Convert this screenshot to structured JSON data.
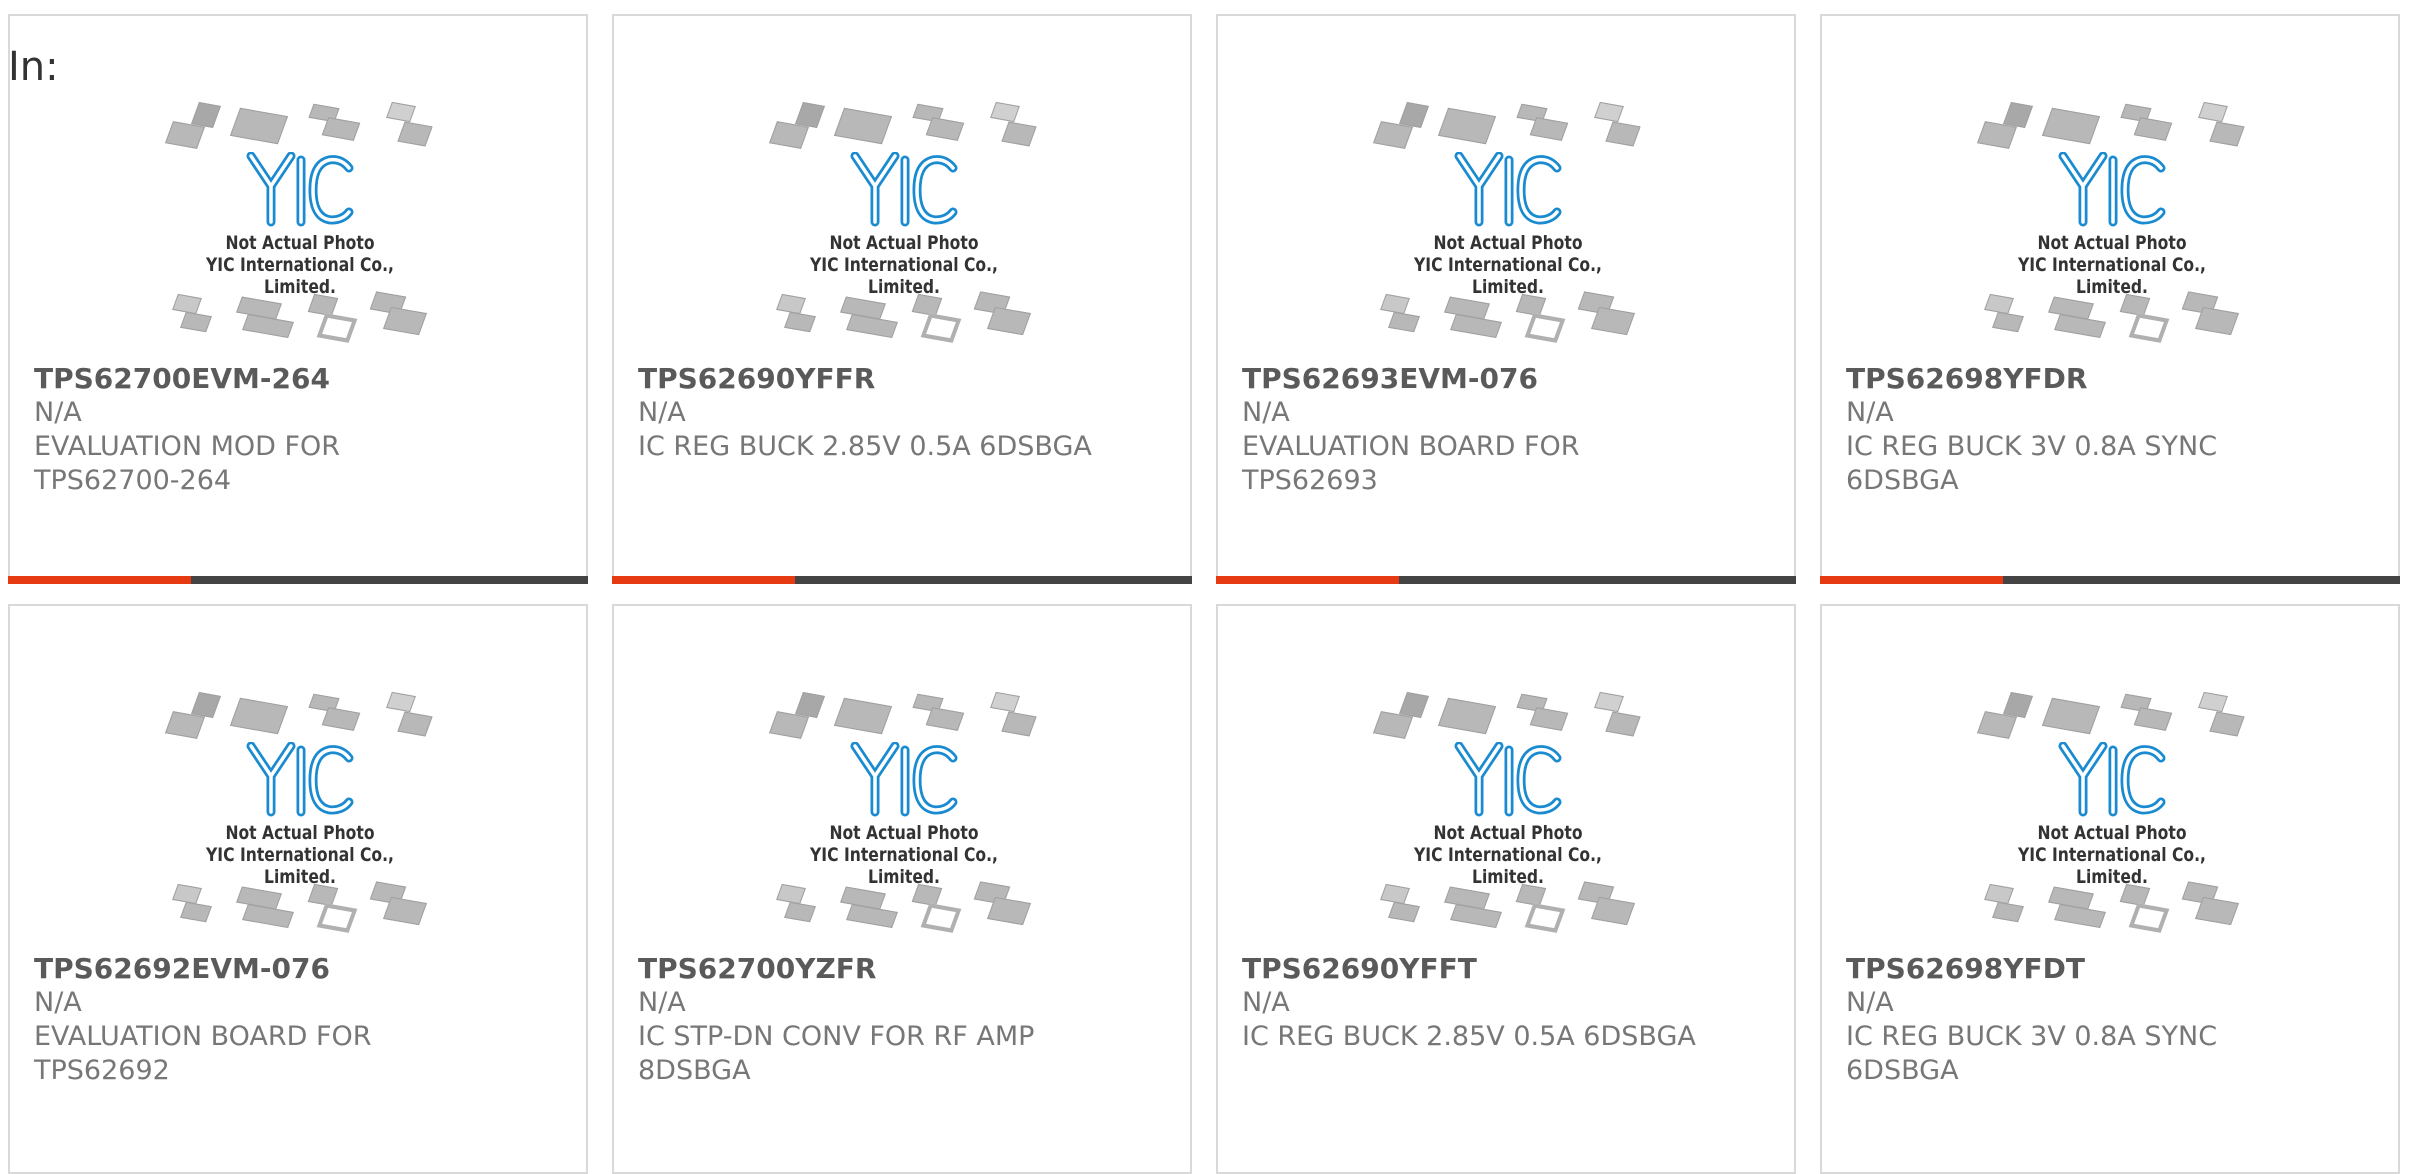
{
  "header": {
    "label": "In:"
  },
  "image": {
    "caption_line1": "Not Actual Photo",
    "caption_line2": "YIC International Co., Limited.",
    "logo_text": "YIC"
  },
  "colors": {
    "accent": "#e53a12",
    "bar_dark": "#444444",
    "logo_blue": "#1a8bd0",
    "border": "#d9d9d9"
  },
  "products": [
    {
      "part": "TPS62700EVM-264",
      "stock": "N/A",
      "desc1": "EVALUATION MOD FOR",
      "desc2": "TPS62700-264"
    },
    {
      "part": "TPS62690YFFR",
      "stock": "N/A",
      "desc1": "IC REG BUCK 2.85V 0.5A 6DSBGA",
      "desc2": ""
    },
    {
      "part": "TPS62693EVM-076",
      "stock": "N/A",
      "desc1": "EVALUATION BOARD FOR",
      "desc2": "TPS62693"
    },
    {
      "part": "TPS62698YFDR",
      "stock": "N/A",
      "desc1": "IC REG BUCK 3V 0.8A SYNC",
      "desc2": "6DSBGA"
    },
    {
      "part": "TPS62692EVM-076",
      "stock": "N/A",
      "desc1": "EVALUATION BOARD FOR",
      "desc2": "TPS62692"
    },
    {
      "part": "TPS62700YZFR",
      "stock": "N/A",
      "desc1": "IC STP-DN CONV FOR RF AMP",
      "desc2": "8DSBGA"
    },
    {
      "part": "TPS62690YFFT",
      "stock": "N/A",
      "desc1": "IC REG BUCK 2.85V 0.5A 6DSBGA",
      "desc2": ""
    },
    {
      "part": "TPS62698YFDT",
      "stock": "N/A",
      "desc1": "IC REG BUCK 3V 0.8A SYNC",
      "desc2": "6DSBGA"
    }
  ]
}
